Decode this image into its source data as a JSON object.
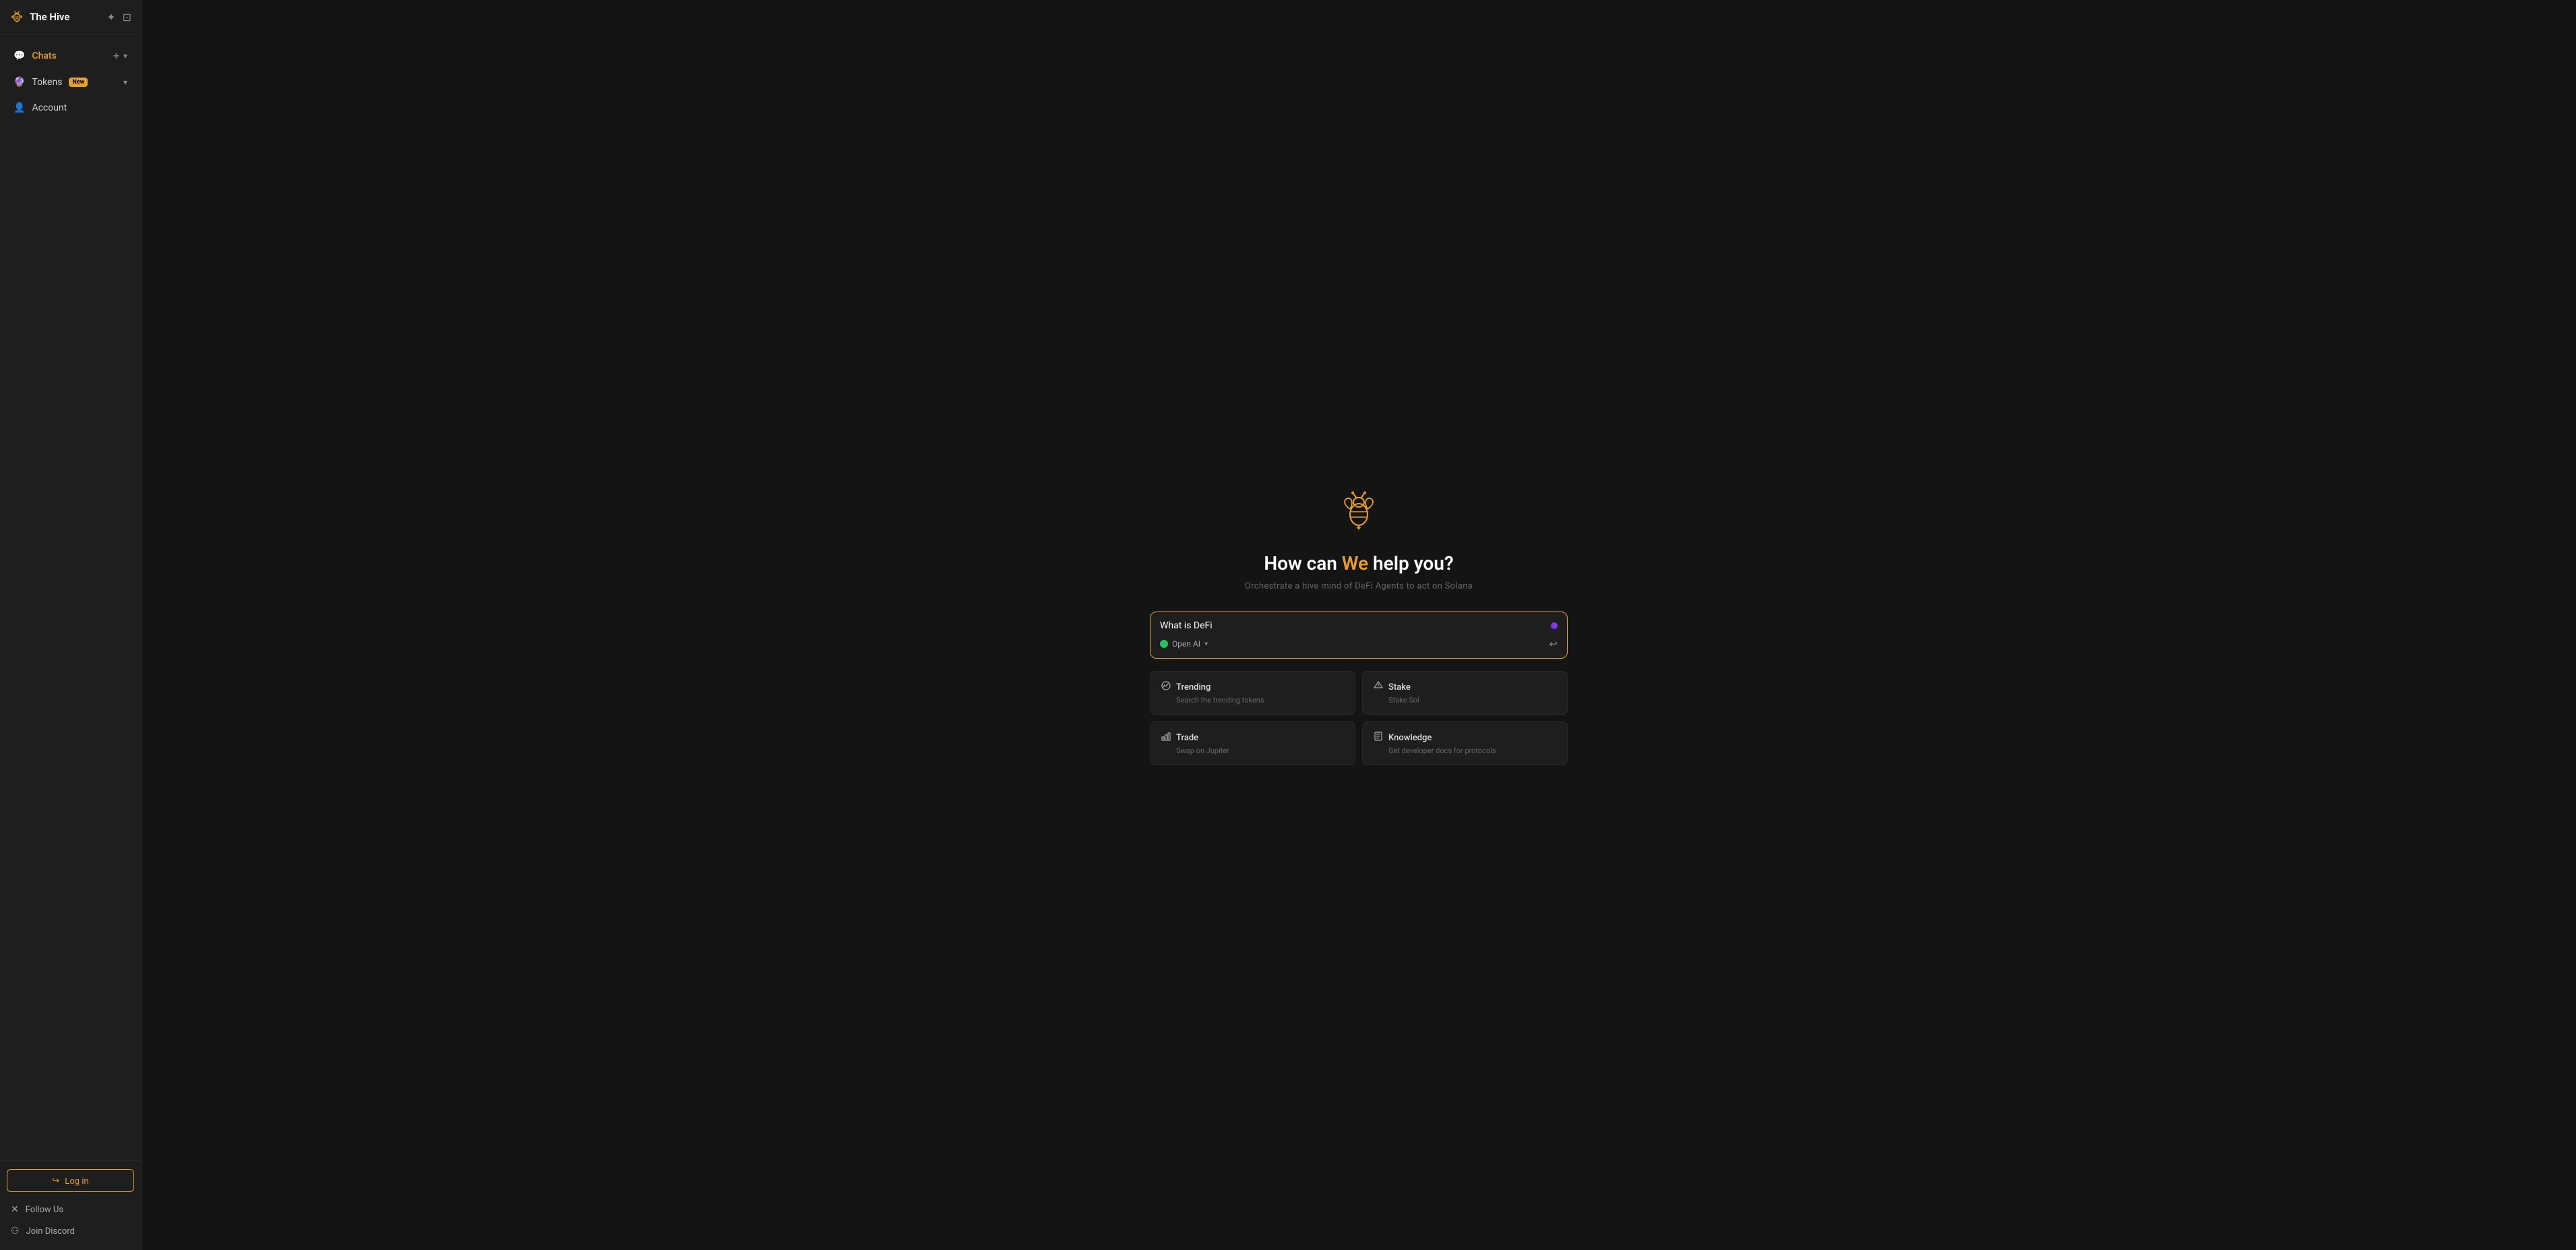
{
  "sidebar": {
    "brand": {
      "name": "The Hive"
    },
    "nav": {
      "chats_label": "Chats",
      "tokens_label": "Tokens",
      "tokens_badge": "New",
      "account_label": "Account"
    },
    "footer": {
      "login_label": "Log in",
      "follow_us_label": "Follow Us",
      "join_discord_label": "Join Discord"
    }
  },
  "main": {
    "title_start": "How can ",
    "title_highlight": "We",
    "title_end": " help you?",
    "subtitle": "Orchestrate a hive mind of DeFi Agents to act on Solana",
    "input_value": "What is DeFi",
    "input_placeholder": "What is DeFi",
    "ai_selector_label": "Open AI",
    "cards": [
      {
        "id": "trending",
        "icon": "📈",
        "title": "Trending",
        "desc": "Search the trending tokens"
      },
      {
        "id": "stake",
        "icon": "⚡",
        "title": "Stake",
        "desc": "Stake Sol"
      },
      {
        "id": "trade",
        "icon": "📊",
        "title": "Trade",
        "desc": "Swap on Jupiter"
      },
      {
        "id": "knowledge",
        "icon": "📚",
        "title": "Knowledge",
        "desc": "Get developer docs for protocols"
      }
    ]
  }
}
